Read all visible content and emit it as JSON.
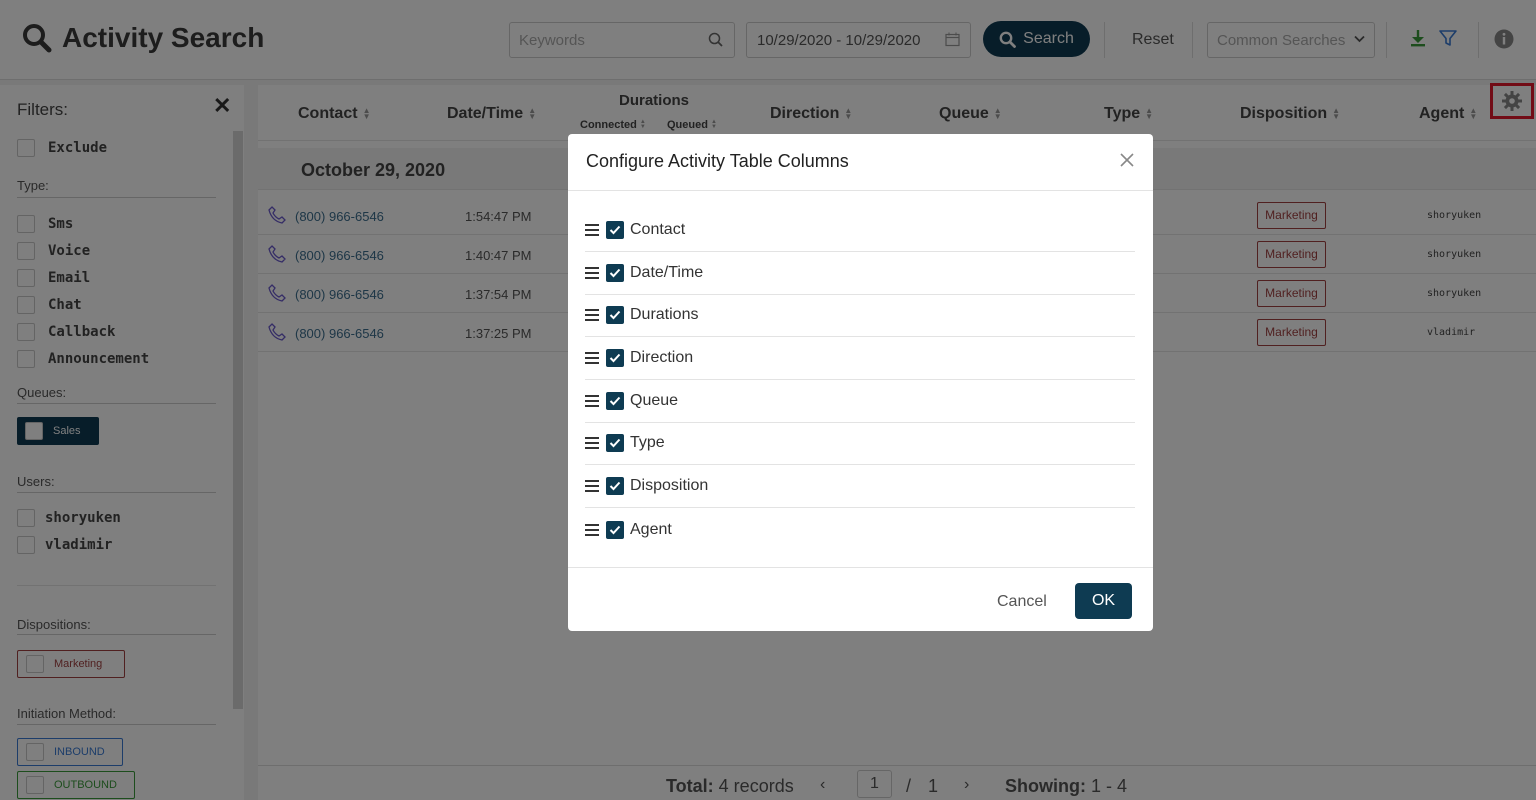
{
  "header": {
    "title": "Activity Search",
    "keywords_placeholder": "Keywords",
    "date_range": "10/29/2020 - 10/29/2020",
    "search_label": "Search",
    "reset_label": "Reset",
    "common_searches_placeholder": "Common Searches"
  },
  "sidebar": {
    "title": "Filters:",
    "exclude_label": "Exclude",
    "type_label": "Type:",
    "types": [
      "Sms",
      "Voice",
      "Email",
      "Chat",
      "Callback",
      "Announcement"
    ],
    "queues_label": "Queues:",
    "queues": [
      "Sales"
    ],
    "users_label": "Users:",
    "users": [
      "shoryuken",
      "vladimir"
    ],
    "dispositions_label": "Dispositions:",
    "dispositions": [
      "Marketing"
    ],
    "initiation_label": "Initiation Method:",
    "initiation_methods": [
      "INBOUND",
      "OUTBOUND"
    ]
  },
  "table": {
    "columns": {
      "contact": "Contact",
      "datetime": "Date/Time",
      "durations": "Durations",
      "connected": "Connected",
      "queued": "Queued",
      "direction": "Direction",
      "queue": "Queue",
      "type": "Type",
      "disposition": "Disposition",
      "agent": "Agent"
    },
    "group_date": "October 29, 2020",
    "rows": [
      {
        "contact": "(800) 966-6546",
        "time": "1:54:47 PM",
        "disposition": "Marketing",
        "agent": "shoryuken"
      },
      {
        "contact": "(800) 966-6546",
        "time": "1:40:47 PM",
        "disposition": "Marketing",
        "agent": "shoryuken"
      },
      {
        "contact": "(800) 966-6546",
        "time": "1:37:54 PM",
        "disposition": "Marketing",
        "agent": "shoryuken"
      },
      {
        "contact": "(800) 966-6546",
        "time": "1:37:25 PM",
        "disposition": "Marketing",
        "agent": "vladimir"
      }
    ]
  },
  "footer": {
    "total_label": "Total:",
    "total_value": "4 records",
    "page": "1",
    "page_sep": "/",
    "page_total": "1",
    "showing_label": "Showing:",
    "showing_value": "1 - 4"
  },
  "modal": {
    "title": "Configure Activity Table Columns",
    "items": [
      "Contact",
      "Date/Time",
      "Durations",
      "Direction",
      "Queue",
      "Type",
      "Disposition",
      "Agent"
    ],
    "cancel_label": "Cancel",
    "ok_label": "OK"
  },
  "colors": {
    "primary": "#0e3b52",
    "disposition": "#a04040",
    "highlight": "#e4182c",
    "link": "#3c6e8f"
  }
}
